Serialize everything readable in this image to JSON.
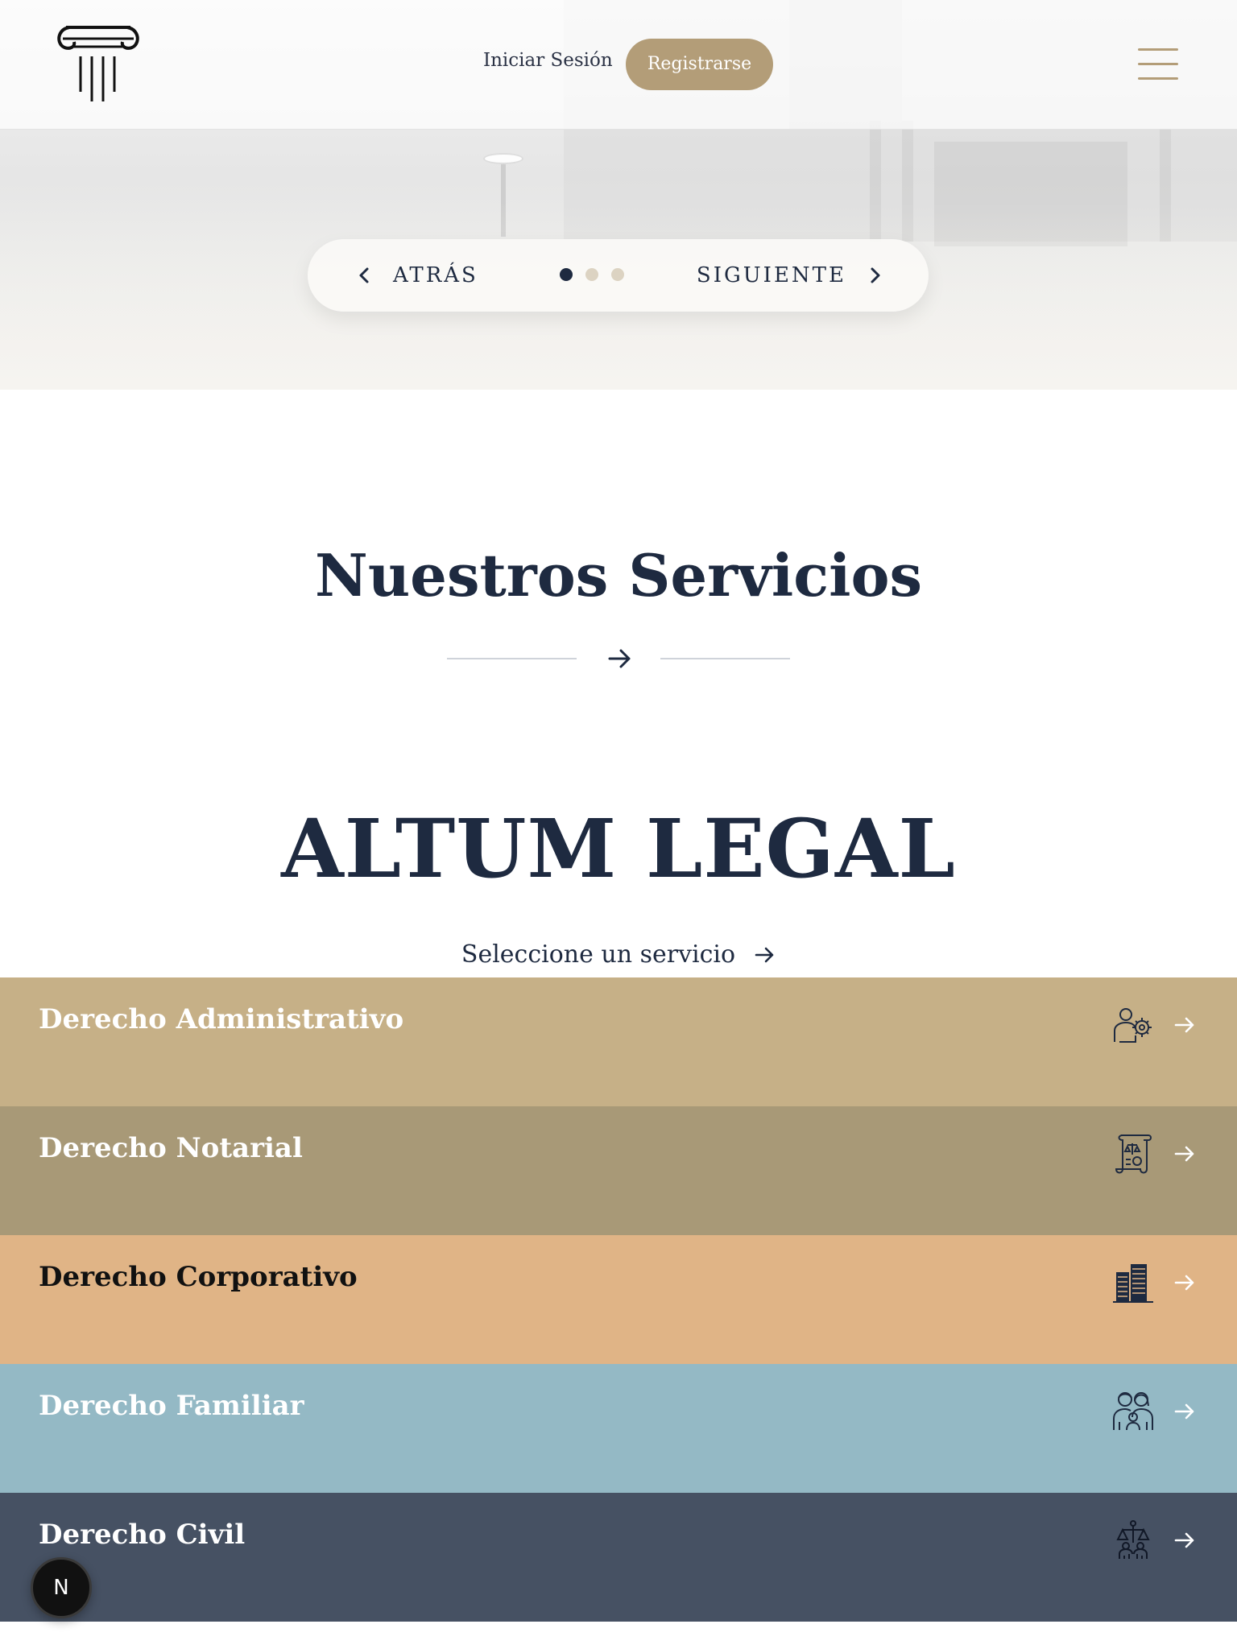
{
  "header": {
    "login_label": "Iniciar Sesión",
    "register_label": "Registrarse"
  },
  "slider": {
    "prev_label": "ATRÁS",
    "next_label": "SIGUIENTE",
    "slide_count": 3,
    "active_slide": 1
  },
  "services_section": {
    "title": "Nuestros Servicios",
    "brand": "ALTUM LEGAL",
    "prompt": "Seleccione un servicio",
    "items": [
      {
        "label": "Derecho Administrativo",
        "bg": "#c6b087",
        "text_color": "#ffffff",
        "icon": "admin-gear-people-icon"
      },
      {
        "label": "Derecho Notarial",
        "bg": "#a89977",
        "text_color": "#ffffff",
        "icon": "notary-scroll-icon"
      },
      {
        "label": "Derecho Corporativo",
        "bg": "#e0b486",
        "text_color": "#111111",
        "icon": "corporate-buildings-icon"
      },
      {
        "label": "Derecho Familiar",
        "bg": "#94b9c5",
        "text_color": "#ffffff",
        "icon": "family-people-icon"
      },
      {
        "label": "Derecho Civil",
        "bg": "#465163",
        "text_color": "#ffffff",
        "icon": "civil-justice-icon"
      }
    ]
  },
  "floating_button": {
    "label": "N"
  },
  "colors": {
    "navy": "#1e2a40",
    "gold": "#b39d78"
  }
}
